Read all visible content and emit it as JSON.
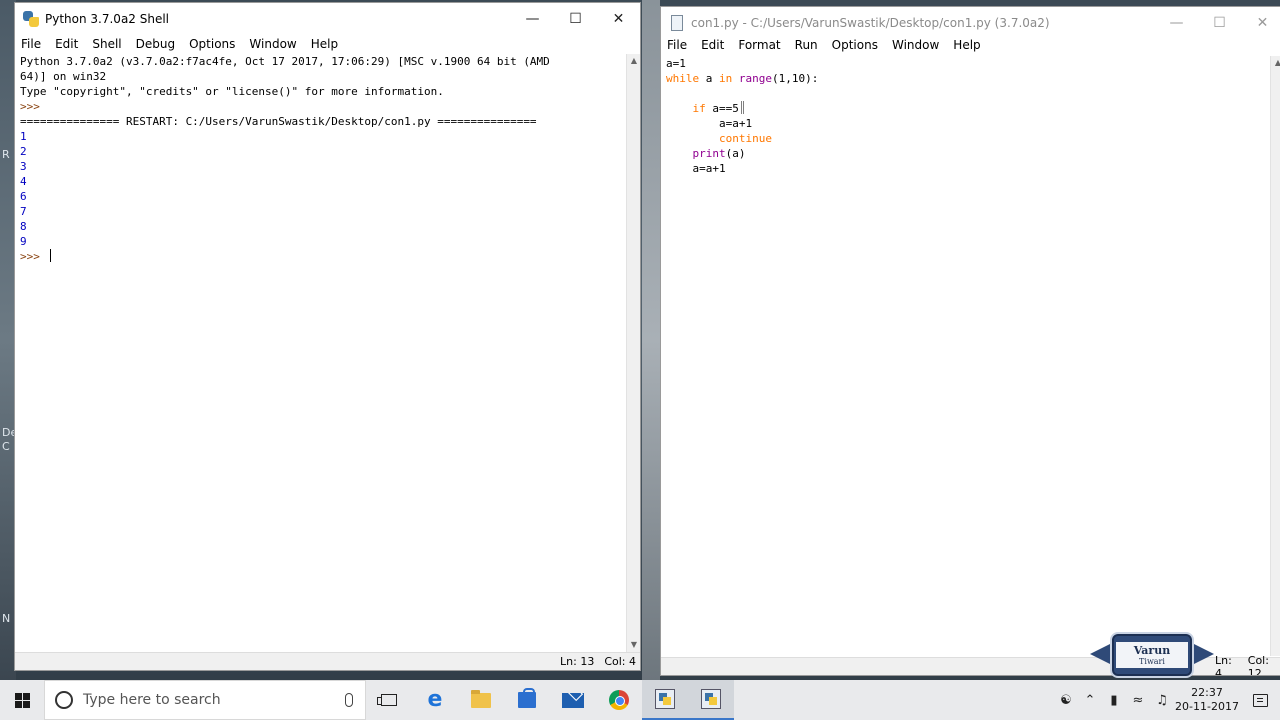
{
  "desktop": {
    "frag1": "R",
    "frag2": "De",
    "frag3": "C",
    "frag4": "N"
  },
  "shell": {
    "title": "Python 3.7.0a2 Shell",
    "menu": [
      "File",
      "Edit",
      "Shell",
      "Debug",
      "Options",
      "Window",
      "Help"
    ],
    "banner": [
      "Python 3.7.0a2 (v3.7.0a2:f7ac4fe, Oct 17 2017, 17:06:29) [MSC v.1900 64 bit (AMD",
      "64)] on win32",
      "Type \"copyright\", \"credits\" or \"license()\" for more information."
    ],
    "prompt": ">>> ",
    "restart_line": "=============== RESTART: C:/Users/VarunSwastik/Desktop/con1.py ===============",
    "output": [
      "1",
      "2",
      "3",
      "4",
      "6",
      "7",
      "8",
      "9"
    ],
    "status": {
      "ln": "Ln: 13",
      "col": "Col: 4"
    }
  },
  "editor": {
    "title": "con1.py - C:/Users/VarunSwastik/Desktop/con1.py (3.7.0a2)",
    "menu": [
      "File",
      "Edit",
      "Format",
      "Run",
      "Options",
      "Window",
      "Help"
    ],
    "code": {
      "l1": "a=1",
      "l2_kw": "while",
      "l2_a": " a ",
      "l2_kw2": "in",
      "l2_sp": " ",
      "l2_bi": "range",
      "l2_rest": "(1,10):",
      "l4_kw": "if",
      "l4_rest": " a==5",
      "l5": "a=a+1",
      "l6_kw": "continue",
      "l7_bi": "print",
      "l7_rest": "(a)",
      "l8": "a=a+1"
    },
    "status": {
      "ln": "Ln: 4",
      "col": "Col: 12"
    }
  },
  "watermark": {
    "name": "Varun",
    "sub": "Tiwari"
  },
  "taskbar": {
    "search_placeholder": "Type here to search",
    "time": "22:37",
    "date": "20-11-2017"
  },
  "colors": {
    "keyword": "#ff7700",
    "builtin": "#900090",
    "output": "#0000c0",
    "accent": "#3a77c9"
  }
}
